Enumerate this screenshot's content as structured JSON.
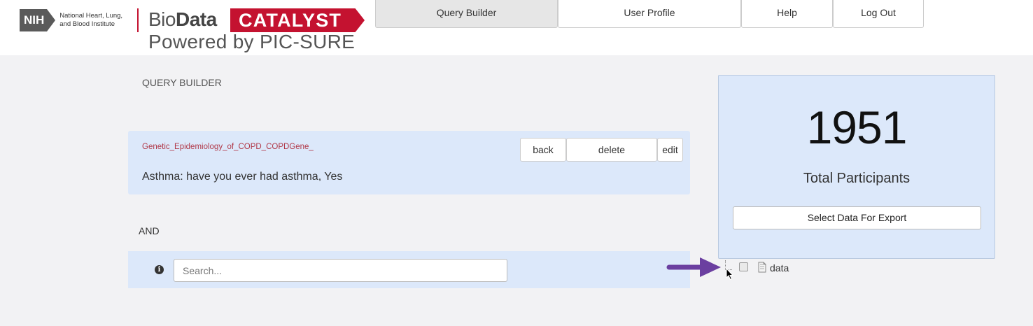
{
  "header": {
    "nih_badge": "NIH",
    "nih_institute": "National Heart, Lung, and Blood Institute",
    "brand_bio": "Bio",
    "brand_data": "Data",
    "brand_catalyst": "CATALYST",
    "powered_by": "Powered by PIC-SURE",
    "brand_color": "#c41230"
  },
  "nav": {
    "tabs": [
      {
        "label": "Query Builder",
        "active": true
      },
      {
        "label": "User Profile",
        "active": false
      },
      {
        "label": "Help",
        "active": false
      },
      {
        "label": "Log Out",
        "active": false
      }
    ]
  },
  "query_builder": {
    "title": "QUERY BUILDER",
    "filter": {
      "study": "Genetic_Epidemiology_of_COPD_COPDGene_",
      "description": "Asthma: have you ever had asthma, Yes",
      "back_label": "back",
      "delete_label": "delete",
      "edit_label": "edit"
    },
    "operator": "AND",
    "search": {
      "placeholder": "Search...",
      "value": "",
      "info_icon": "info-circle-icon"
    }
  },
  "results": {
    "count": "1951",
    "count_label": "Total Participants",
    "export_label": "Select Data For Export"
  },
  "tree": {
    "node_label": "data",
    "node_icon": "file-icon",
    "checked": false
  },
  "annotation": {
    "arrow_color": "#6b3fa0",
    "arrow_icon": "right-arrow-icon"
  }
}
